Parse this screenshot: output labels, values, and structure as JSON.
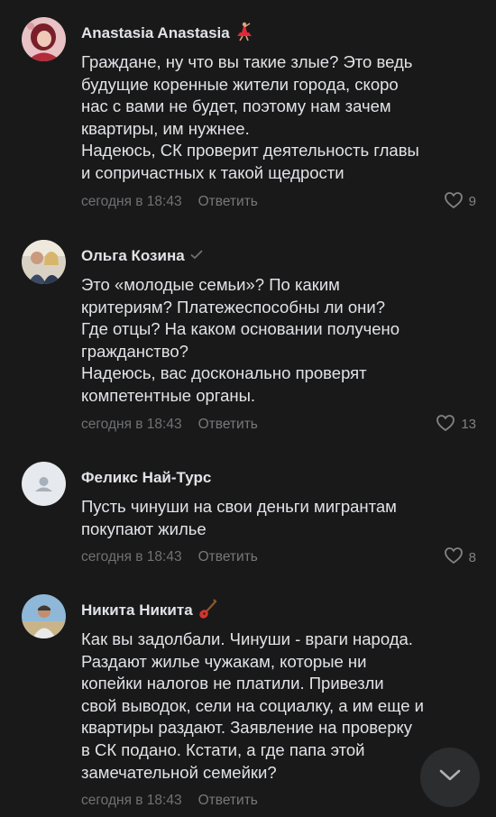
{
  "comments": [
    {
      "author": "Anastasia Anastasia",
      "badge": "dancer-emoji",
      "text": "Граждане, ну что вы такие злые? Это ведь\nбудущие коренные жители города, скоро\nнас с вами не будет, поэтому нам зачем\nквартиры, им нужнее.\nНадеюсь, СК проверит деятельность главы\nи сопричастных к такой щедрости",
      "date": "сегодня в 18:43",
      "reply": "Ответить",
      "likes": "9"
    },
    {
      "author": "Ольга Козина",
      "badge": "verified-check",
      "text": "Это «молодые семьи»? По каким\nкритериям? Платежеспособны ли они?\nГде отцы? На каком основании получено\nгражданство?\nНадеюсь, вас досконально проверят\nкомпетентные органы.",
      "date": "сегодня в 18:43",
      "reply": "Ответить",
      "likes": "13"
    },
    {
      "author": "Феликс Най-Турс",
      "badge": "",
      "text": "Пусть чинуши на свои деньги мигрантам\nпокупают жилье",
      "date": "сегодня в 18:43",
      "reply": "Ответить",
      "likes": "8"
    },
    {
      "author": "Никита Никита",
      "badge": "guitar-emoji",
      "text": "Как вы задолбали. Чинуши - враги народа.\nРаздают жилье чужакам, которые ни\nкопейки налогов не платили. Привезли\nсвой выводок, сели на социалку, а им еще и\nквартиры раздают. Заявление на проверку\nв СК подано. Кстати, а где папа этой\nзамечательной семейки?",
      "date": "сегодня в 18:43",
      "reply": "Ответить",
      "likes": ""
    }
  ],
  "colors": {
    "background": "#19191a",
    "text": "#e1e3e6",
    "secondary": "#6f7173"
  },
  "icons": {
    "like": "heart-outline-icon",
    "scroll": "chevron-down-icon"
  }
}
